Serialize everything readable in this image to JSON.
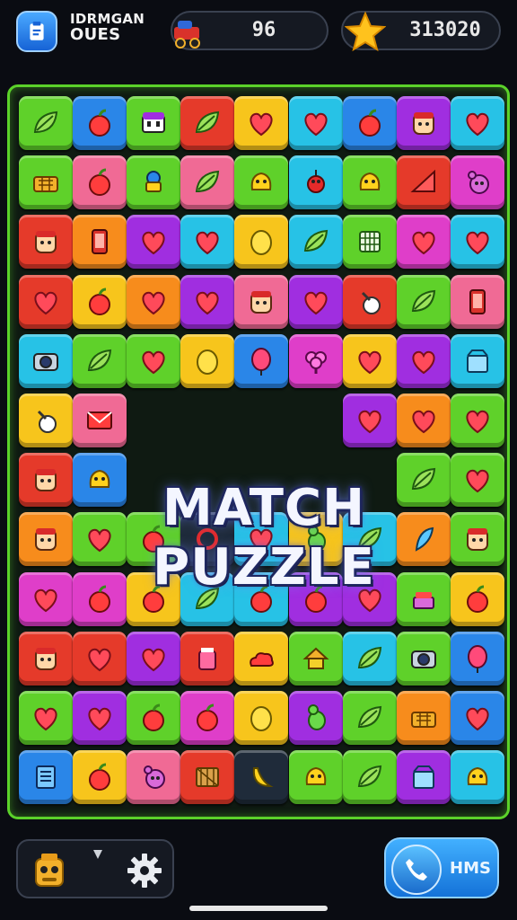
{
  "hud": {
    "app_icon": "clipboard-icon",
    "title_line1": "IDRMGAN",
    "title_line2": "OUES",
    "moves_icon": "cart-icon",
    "moves_value": "96",
    "score_icon": "star-icon",
    "score_value": "313020"
  },
  "board": {
    "title_line1": "MATCH",
    "title_line2": "PUZZLE",
    "border_color": "#5bd22a",
    "colors": {
      "g": "#5fd12a",
      "b": "#2a86e8",
      "r": "#e53a2a",
      "y": "#f7c51c",
      "c": "#27c2e6",
      "p": "#a02ee0",
      "m": "#df3ec9",
      "pk": "#f06a95",
      "o": "#f78c1c",
      "dk": "#1f2b3a"
    },
    "rows": [
      [
        [
          "g",
          "leaf"
        ],
        [
          "b",
          "apple"
        ],
        [
          "g",
          "bag"
        ],
        [
          "r",
          "leaf"
        ],
        [
          "y",
          "heart"
        ],
        [
          "c",
          "heart"
        ],
        [
          "b",
          "apple"
        ],
        [
          "p",
          "face"
        ],
        [
          "c",
          "heart"
        ]
      ],
      [
        [
          "g",
          "basket"
        ],
        [
          "pk",
          "apple"
        ],
        [
          "g",
          "blocks"
        ],
        [
          "pk",
          "leaf"
        ],
        [
          "g",
          "blob"
        ],
        [
          "c",
          "cherry"
        ],
        [
          "g",
          "blob"
        ],
        [
          "r",
          "triangle"
        ],
        [
          "m",
          "bear"
        ]
      ],
      [
        [
          "r",
          "face"
        ],
        [
          "o",
          "phone"
        ],
        [
          "p",
          "heart"
        ],
        [
          "c",
          "heart"
        ],
        [
          "y",
          "lemon"
        ],
        [
          "c",
          "leaf"
        ],
        [
          "g",
          "cage"
        ],
        [
          "m",
          "heart"
        ],
        [
          "c",
          "heart"
        ]
      ],
      [
        [
          "r",
          "heart"
        ],
        [
          "y",
          "apple"
        ],
        [
          "o",
          "heart"
        ],
        [
          "p",
          "heart"
        ],
        [
          "pk",
          "face"
        ],
        [
          "p",
          "heart"
        ],
        [
          "r",
          "bell"
        ],
        [
          "g",
          "leaf"
        ],
        [
          "pk",
          "phone"
        ]
      ],
      [
        [
          "c",
          "camera"
        ],
        [
          "g",
          "leaf"
        ],
        [
          "g",
          "heart"
        ],
        [
          "y",
          "lemon"
        ],
        [
          "b",
          "balloon"
        ],
        [
          "m",
          "tree"
        ],
        [
          "y",
          "heart"
        ],
        [
          "p",
          "heart"
        ],
        [
          "c",
          "box"
        ]
      ],
      [
        [
          "y",
          "bell"
        ],
        [
          "pk",
          "envelope"
        ],
        [
          "",
          ""
        ],
        [
          "",
          ""
        ],
        [
          "",
          ""
        ],
        [
          "",
          ""
        ],
        [
          "p",
          "heart"
        ],
        [
          "o",
          "heart"
        ],
        [
          "g",
          "heart"
        ]
      ],
      [
        [
          "r",
          "face"
        ],
        [
          "b",
          "blob"
        ],
        [
          "",
          ""
        ],
        [
          "",
          ""
        ],
        [
          "",
          ""
        ],
        [
          "",
          ""
        ],
        [
          "",
          ""
        ],
        [
          "g",
          "leaf"
        ],
        [
          "g",
          "heart"
        ]
      ],
      [
        [
          "o",
          "face"
        ],
        [
          "g",
          "heart"
        ],
        [
          "g",
          "apple"
        ],
        [
          "dk",
          "ring"
        ],
        [
          "c",
          "heart"
        ],
        [
          "y",
          "bird"
        ],
        [
          "c",
          "leaf"
        ],
        [
          "o",
          "feather"
        ],
        [
          "g",
          "face"
        ]
      ],
      [
        [
          "m",
          "heart"
        ],
        [
          "m",
          "apple"
        ],
        [
          "y",
          "apple"
        ],
        [
          "c",
          "leaf"
        ],
        [
          "c",
          "apple"
        ],
        [
          "p",
          "apple"
        ],
        [
          "p",
          "heart"
        ],
        [
          "g",
          "cake"
        ],
        [
          "y",
          "apple"
        ]
      ],
      [
        [
          "r",
          "face"
        ],
        [
          "r",
          "heart"
        ],
        [
          "p",
          "heart"
        ],
        [
          "r",
          "jar"
        ],
        [
          "y",
          "cloud"
        ],
        [
          "g",
          "house"
        ],
        [
          "c",
          "leaf"
        ],
        [
          "g",
          "camera"
        ],
        [
          "b",
          "balloon"
        ]
      ],
      [
        [
          "g",
          "heart"
        ],
        [
          "p",
          "heart"
        ],
        [
          "g",
          "apple"
        ],
        [
          "m",
          "apple"
        ],
        [
          "y",
          "lemon"
        ],
        [
          "p",
          "bird"
        ],
        [
          "g",
          "leaf"
        ],
        [
          "o",
          "basket"
        ],
        [
          "b",
          "heart"
        ]
      ],
      [
        [
          "b",
          "note"
        ],
        [
          "y",
          "apple"
        ],
        [
          "pk",
          "bear"
        ],
        [
          "r",
          "crate"
        ],
        [
          "dk",
          "banana"
        ],
        [
          "g",
          "blob"
        ],
        [
          "g",
          "leaf"
        ],
        [
          "p",
          "box"
        ],
        [
          "c",
          "blob"
        ]
      ]
    ]
  },
  "footer": {
    "robot_icon": "robot-icon",
    "settings_icon": "gear-icon",
    "call_icon": "phone-icon",
    "call_label": "HMS"
  }
}
